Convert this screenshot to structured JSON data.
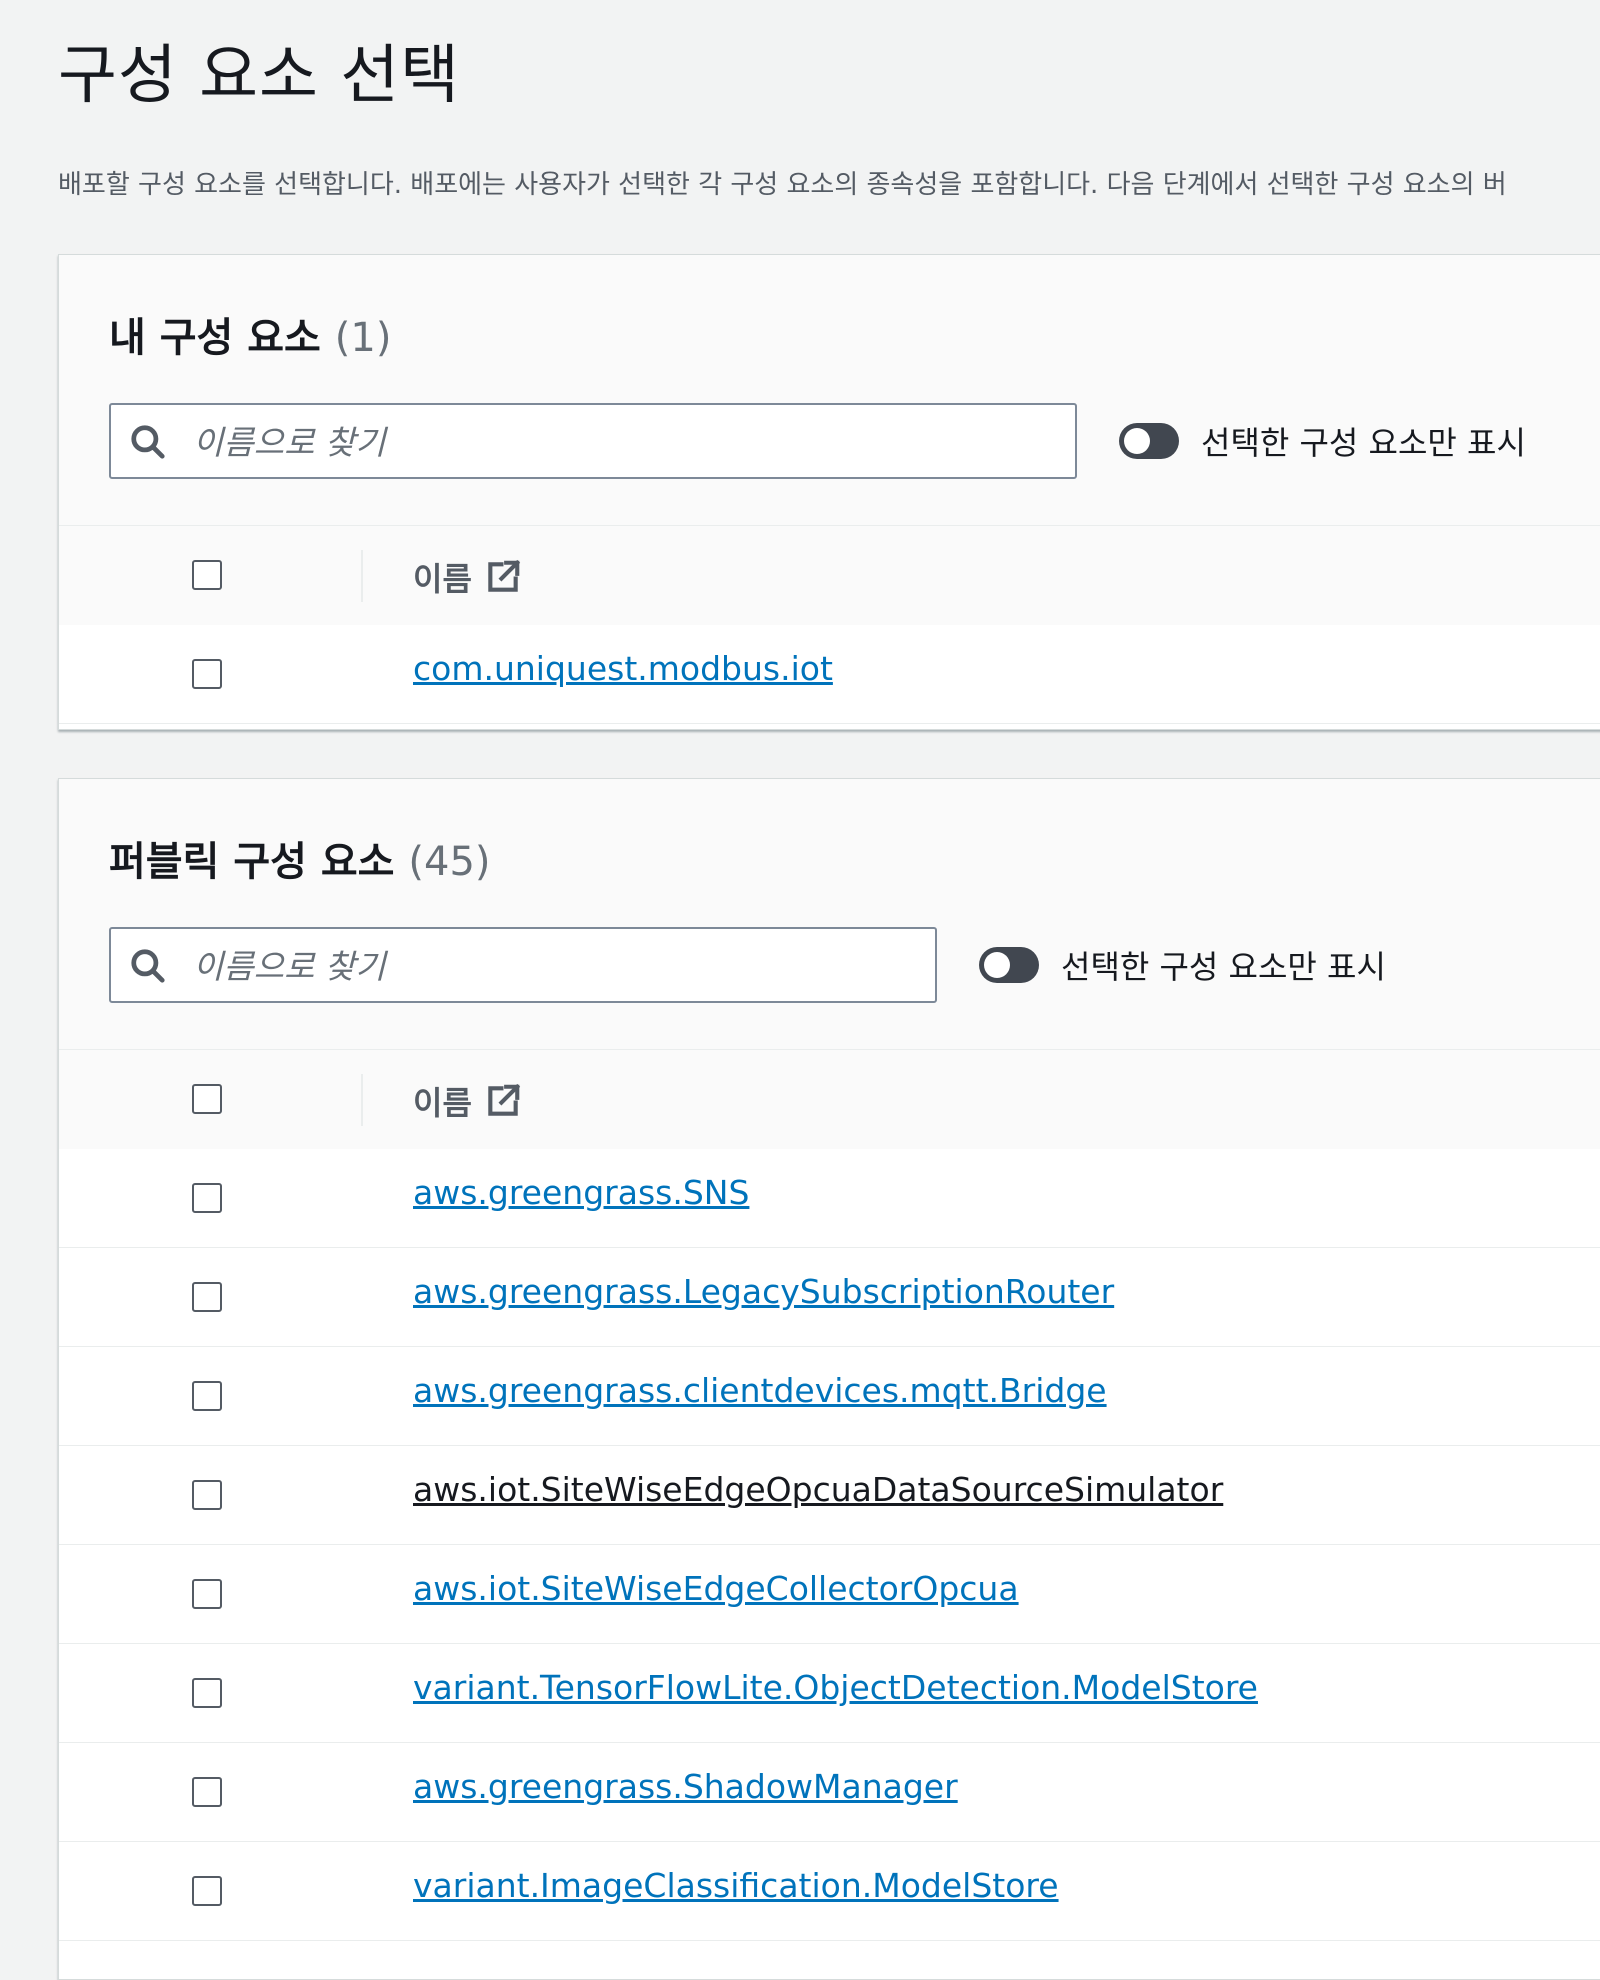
{
  "page": {
    "title": "구성 요소 선택",
    "description": "배포할 구성 요소를 선택합니다. 배포에는 사용자가 선택한 각 구성 요소의 종속성을 포함합니다. 다음 단계에서 선택한 구성 요소의 버"
  },
  "my_components": {
    "title": "내 구성 요소",
    "count": "(1)",
    "search_placeholder": "이름으로 찾기",
    "toggle_label": "선택한 구성 요소만 표시",
    "column_name": "이름",
    "rows": [
      "com.uniquest.modbus.iot"
    ]
  },
  "public_components": {
    "title": "퍼블릭 구성 요소",
    "count": "(45)",
    "search_placeholder": "이름으로 찾기",
    "toggle_label": "선택한 구성 요소만 표시",
    "column_name": "이름",
    "rows": [
      "aws.greengrass.SNS",
      "aws.greengrass.LegacySubscriptionRouter",
      "aws.greengrass.clientdevices.mqtt.Bridge",
      "aws.iot.SiteWiseEdgeOpcuaDataSourceSimulator",
      "aws.iot.SiteWiseEdgeCollectorOpcua",
      "variant.TensorFlowLite.ObjectDetection.ModelStore",
      "aws.greengrass.ShadowManager",
      "variant.ImageClassification.ModelStore"
    ]
  },
  "icons": {
    "search": "search-icon",
    "external_link": "external-link-icon"
  },
  "colors": {
    "link": "#0073bb",
    "toggle_off": "#414750",
    "background": "#f2f3f3"
  }
}
